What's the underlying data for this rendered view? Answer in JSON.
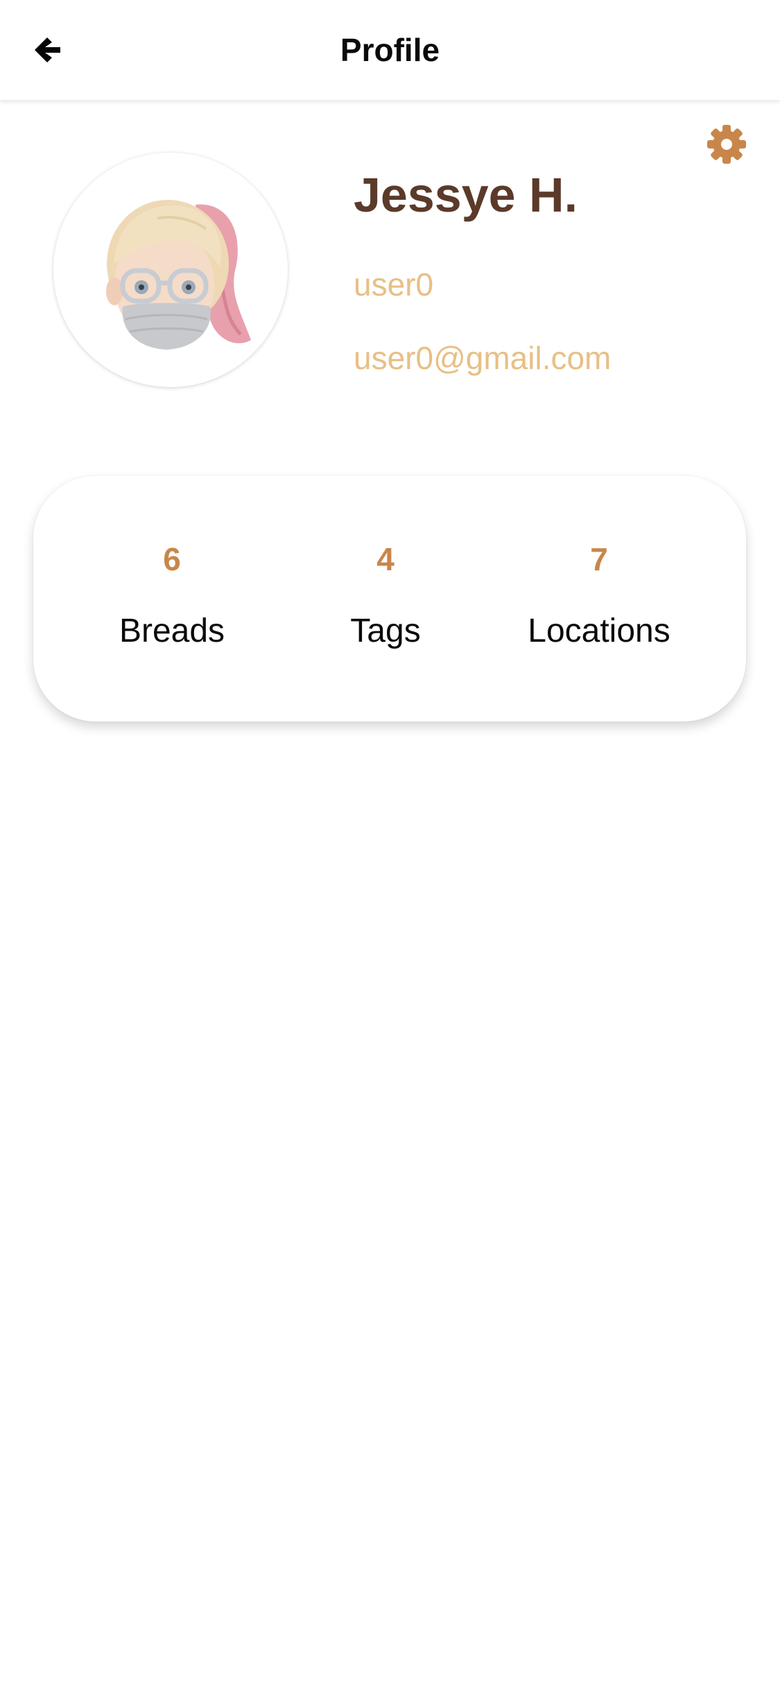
{
  "header": {
    "title": "Profile",
    "back_icon": "arrow-left-icon"
  },
  "settings": {
    "icon": "gear-icon"
  },
  "profile": {
    "avatar_icon": "memoji-avatar",
    "full_name": "Jessye H.",
    "username": "user0",
    "email": "user0@gmail.com"
  },
  "stats": [
    {
      "value": "6",
      "label": "Breads"
    },
    {
      "value": "4",
      "label": "Tags"
    },
    {
      "value": "7",
      "label": "Locations"
    }
  ],
  "colors": {
    "name": "#5b3a29",
    "secondary_text": "#e8bf84",
    "accent": "#c9864a",
    "text": "#0a0a0a",
    "background": "#ffffff"
  }
}
